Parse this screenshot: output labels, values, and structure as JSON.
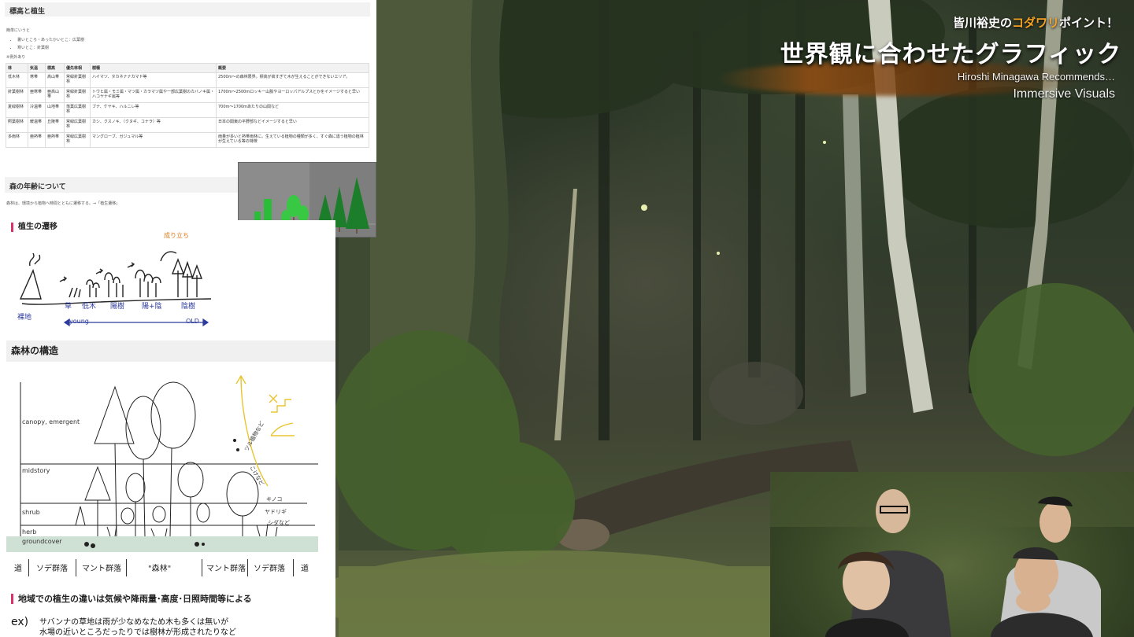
{
  "overlay": {
    "kicker_pre": "皆川裕史の",
    "kicker_highlight": "コダワリ",
    "kicker_post": "ポイント！",
    "title": "世界観に合わせたグラフィック",
    "subtitle_line1": "Hiroshi Minagawa Recommends…",
    "subtitle_line2": "Immersive Visuals",
    "accent_color": "#f4a123"
  },
  "document": {
    "heading": "標高と植生",
    "intro": "簡単にいうと",
    "bullets": [
      "暑いところ・あったかいとこ：広葉樹",
      "寒いとこ：針葉樹"
    ],
    "note": "※例外あり",
    "table": {
      "headers": [
        "林",
        "気温",
        "標高",
        "優先林相",
        "樹種",
        "概要"
      ],
      "rows": [
        [
          "低木林",
          "寒帯",
          "高山帯",
          "常緑針葉樹林",
          "ハイマツ、タカネナナカマド等",
          "2500m〜の森林限界。標高が高すぎて木が生えることができないエリア。"
        ],
        [
          "針葉樹林",
          "亜寒帯",
          "亜高山帯",
          "常緑針葉樹林",
          "トウヒ属・モミ属・マツ属・カラマツ属や一部広葉樹のカバノキ属・ハコヤナギ属等",
          "1700m〜2500mロッキー山脈やヨーロッパアルプスとかをイメージすると早い"
        ],
        [
          "夏緑樹林",
          "冷温帯",
          "山地帯",
          "落葉広葉樹林",
          "ブナ、ケヤキ、ハルニレ等",
          "700m〜1700mあたりの山間など"
        ],
        [
          "照葉樹林",
          "暖温帯",
          "丘陵帯",
          "常緑広葉樹林",
          "カシ、クスノキ、（クヌギ、コナラ）等",
          "日本の関東の平野部などイメージすると早い"
        ],
        [
          "多雨林",
          "亜熱帯",
          "亜熱帯",
          "常緑広葉樹林",
          "マングローブ、ガジュマル等",
          "雨量が多いと熱帯雨林に。生えている植物の種類が多く、すぐ森に違う植物の植林が生えている等の特徴"
        ]
      ]
    },
    "section2_heading": "森の年齢について",
    "section2_note": "森林は、環境から植物へ時間とともに遷移する。⇒「植生遷移」"
  },
  "notes": {
    "succession_heading": "植生の遷移",
    "succession_labels": {
      "bare": "裸地",
      "grass": "草",
      "shrub": "低木",
      "sun_trees": "陽樹",
      "mixed": "陽+陰",
      "shade_trees": "陰樹",
      "young": "young",
      "old": "OLD",
      "arrow_note": "成り立ち"
    },
    "structure_heading": "森林の構造",
    "layers": [
      "canopy, emergent",
      "midstory",
      "shrub",
      "herb",
      "groundcover"
    ],
    "vine_labels": [
      "ツル植物など",
      "こけなど",
      "キノコ",
      "ヤドリギ",
      "シダなど"
    ],
    "strip": [
      "道",
      "ソデ群落",
      "マント群落",
      "\"森林\"",
      "マント群落",
      "ソデ群落",
      "道"
    ],
    "bottom_heading": "地域での植生の違いは気候や降雨量･高度･日照時間等による",
    "example_mark": "ex)",
    "example_line1": "サバンナの草地は雨が少なめなため木も多くは無いが",
    "example_line2": "水場の近いところだったりでは樹林が形成されたりなど"
  },
  "colors": {
    "heading_bar": "#d9336a",
    "groundcover_band": "#cfe0d4",
    "handwriting_blue": "#2d3a9e",
    "handwriting_yellow": "#e8c530",
    "handwriting_orange": "#e07a1a"
  }
}
